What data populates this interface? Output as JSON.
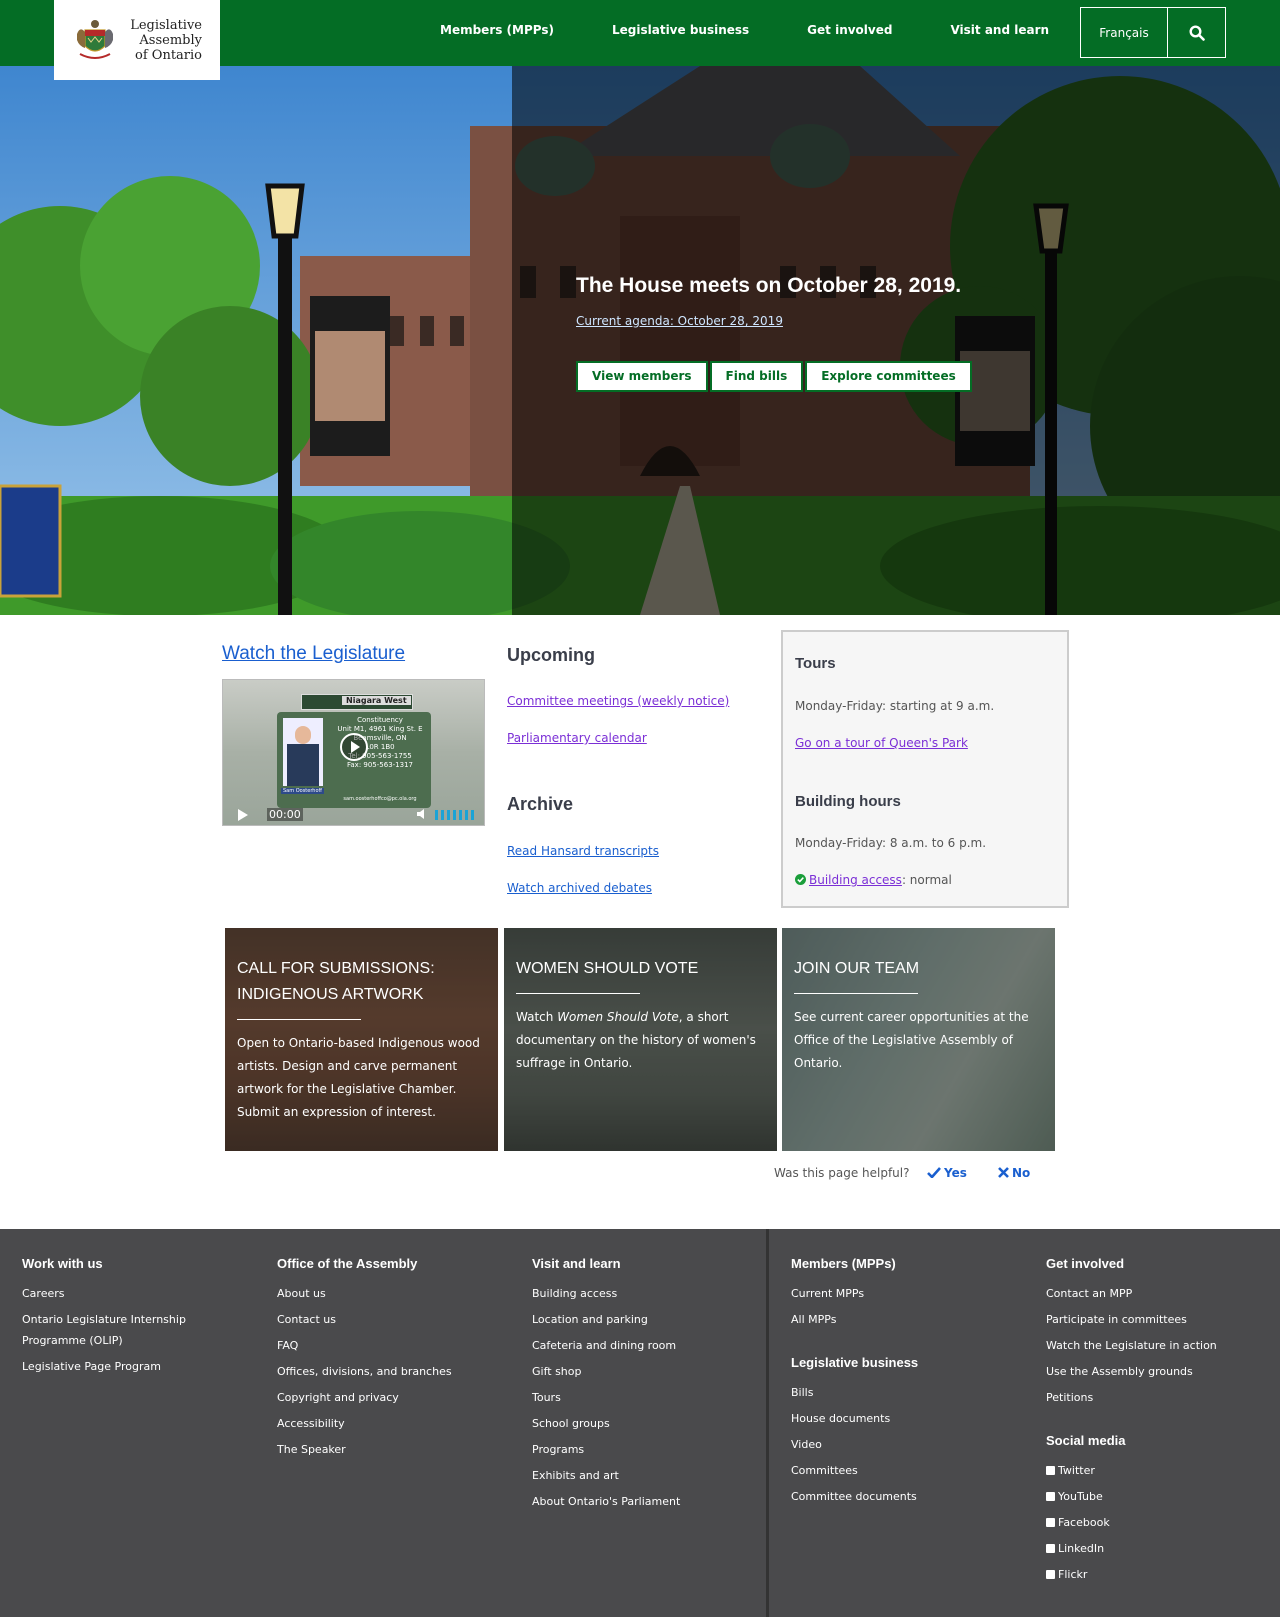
{
  "header": {
    "logo_lines": [
      "Legislative",
      "Assembly",
      "of Ontario"
    ],
    "nav": [
      "Members (MPPs)",
      "Legislative business",
      "Get involved",
      "Visit and learn"
    ],
    "language": "Français"
  },
  "hero": {
    "title": "The House meets on October 28, 2019.",
    "agenda_link": "Current agenda: October 28, 2019",
    "buttons": [
      "View members",
      "Find bills",
      "Explore committees"
    ]
  },
  "watch": {
    "title": "Watch the Legislature",
    "video": {
      "banner": "Niagara West",
      "card_lines": [
        "Constituency",
        "Unit M1, 4961 King St. E",
        "Beamsville, ON",
        "L0R 1B0",
        "Tel: 905-563-1755",
        "Fax: 905-563-1317"
      ],
      "name": "Sam Oosterhoff",
      "email": "sam.oosterhoffco@pc.ola.org",
      "time": "00:00"
    }
  },
  "upcoming": {
    "title": "Upcoming",
    "links": [
      "Committee meetings (weekly notice)",
      "Parliamentary calendar"
    ]
  },
  "archive": {
    "title": "Archive",
    "links": [
      "Read Hansard transcripts",
      "Watch archived debates"
    ]
  },
  "info": {
    "tours_title": "Tours",
    "tours_hours": "Monday-Friday: starting at 9 a.m.",
    "tours_link": "Go on a tour of Queen's Park",
    "building_title": "Building hours",
    "building_hours": "Monday-Friday: 8 a.m. to 6 p.m.",
    "access_link": "Building access",
    "access_status": ": normal"
  },
  "cards": [
    {
      "title": "Call for submissions: Indigenous artwork",
      "text": "Open to Ontario-based Indigenous wood artists. Design and carve permanent artwork for the Legislative Chamber. Submit an expression of interest."
    },
    {
      "title": "Women should vote",
      "text_before": "Watch ",
      "text_italic": "Women Should Vote",
      "text_after": ", a short documentary on the history of women's suffrage in Ontario."
    },
    {
      "title": "Join our team",
      "text": "See current career opportunities at the Office of the Legislative Assembly of Ontario."
    }
  ],
  "helpful": {
    "question": "Was this page helpful?",
    "yes": "Yes",
    "no": "No"
  },
  "footer": {
    "work": {
      "title": "Work with us",
      "links": [
        "Careers",
        "Ontario Legislature Internship",
        "Programme (OLIP)",
        "Legislative Page Program"
      ]
    },
    "office": {
      "title": "Office of the Assembly",
      "links": [
        "About us",
        "Contact us",
        "FAQ",
        "Offices, divisions, and branches",
        "Copyright and privacy",
        "Accessibility",
        "The Speaker"
      ]
    },
    "visit": {
      "title": "Visit and learn",
      "links": [
        "Building access",
        "Location and parking",
        "Cafeteria and dining room",
        "Gift shop",
        "Tours",
        "School groups",
        "Programs",
        "Exhibits and art",
        "About Ontario's Parliament"
      ]
    },
    "members": {
      "title": "Members (MPPs)",
      "links": [
        "Current MPPs",
        "All MPPs"
      ]
    },
    "legislative": {
      "title": "Legislative business",
      "links": [
        "Bills",
        "House documents",
        "Video",
        "Committees",
        "Committee documents"
      ]
    },
    "involved": {
      "title": "Get involved",
      "links": [
        "Contact an MPP",
        "Participate in committees",
        "Watch the Legislature in action",
        "Use the Assembly grounds",
        "Petitions"
      ]
    },
    "social": {
      "title": "Social media",
      "links": [
        "Twitter",
        "YouTube",
        "Facebook",
        "LinkedIn",
        "Flickr"
      ]
    }
  },
  "colors": {
    "brand_green": "#046d25",
    "footer_bg": "#4a4a4c",
    "link_blue": "#1a5fcf",
    "link_purple": "#7b2fd6"
  }
}
